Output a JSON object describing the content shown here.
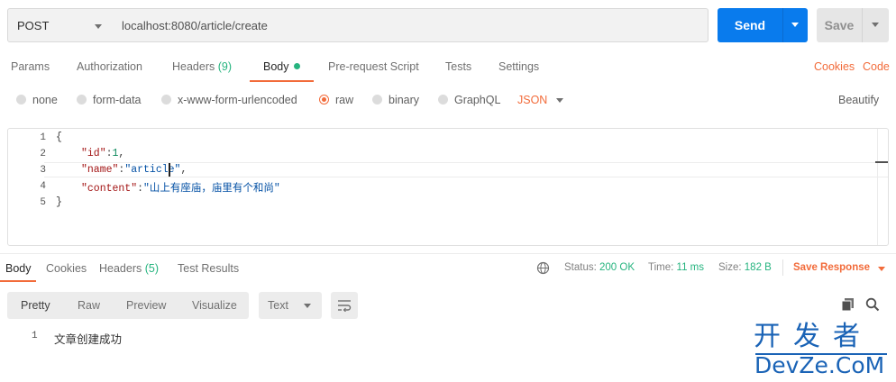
{
  "request": {
    "method": "POST",
    "url": "localhost:8080/article/create",
    "send_label": "Send",
    "save_label": "Save"
  },
  "request_tabs": {
    "params": "Params",
    "authorization": "Authorization",
    "headers": "Headers",
    "headers_count": "(9)",
    "body": "Body",
    "prerequest": "Pre-request Script",
    "tests": "Tests",
    "settings": "Settings",
    "cookies": "Cookies",
    "code": "Code"
  },
  "body_types": {
    "none": "none",
    "form_data": "form-data",
    "urlencoded": "x-www-form-urlencoded",
    "raw": "raw",
    "binary": "binary",
    "graphql": "GraphQL",
    "format": "JSON",
    "beautify": "Beautify",
    "selected": "raw"
  },
  "editor": {
    "line_numbers": [
      "1",
      "2",
      "3",
      "4",
      "5"
    ],
    "open_brace": "{",
    "close_brace": "}",
    "id_key": "\"id\"",
    "id_value": "1",
    "name_key": "\"name\"",
    "name_value": "\"article\"",
    "content_key": "\"content\"",
    "content_value": "\"山上有座庙，庙里有个和尚\""
  },
  "response_tabs": {
    "body": "Body",
    "cookies": "Cookies",
    "headers": "Headers",
    "headers_count": "(5)",
    "test_results": "Test Results"
  },
  "response_meta": {
    "status_label": "Status:",
    "status_value": "200 OK",
    "time_label": "Time:",
    "time_value": "11 ms",
    "size_label": "Size:",
    "size_value": "182 B",
    "save_response": "Save Response"
  },
  "response_view": {
    "pretty": "Pretty",
    "raw": "Raw",
    "preview": "Preview",
    "visualize": "Visualize",
    "text_format": "Text",
    "line_number": "1",
    "line_text": "文章创建成功"
  },
  "watermark": {
    "top": "开发者",
    "bottom": "DevZe.CoM"
  },
  "colors": {
    "accent": "#f26b3a",
    "primary": "#097bed",
    "success": "#26b47f"
  }
}
